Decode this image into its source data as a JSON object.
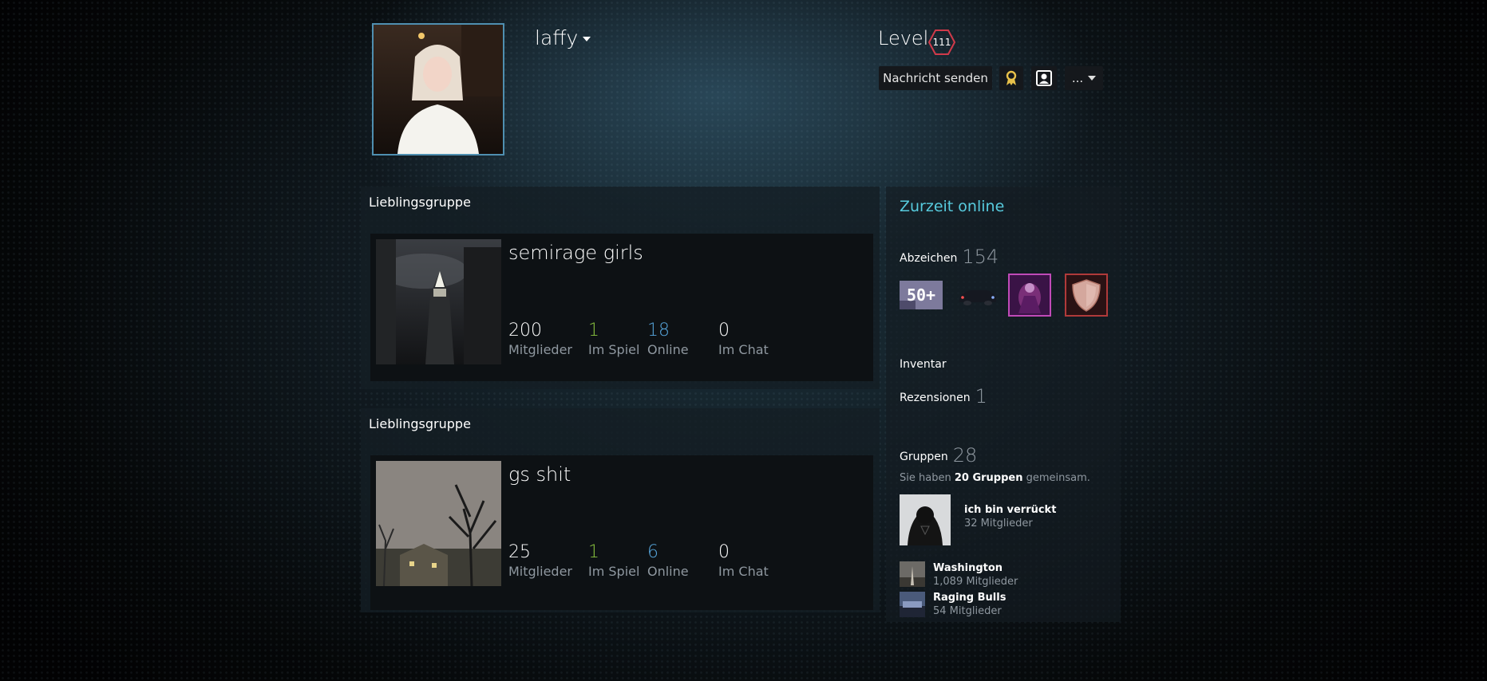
{
  "profile": {
    "username": "laffy",
    "level_label": "Level",
    "level": "111"
  },
  "actions": {
    "send_message": "Nachricht senden",
    "more": "..."
  },
  "favorite_groups": [
    {
      "title": "Lieblingsgruppe",
      "name": "semirage girls",
      "stats": [
        {
          "value": "200",
          "label": "Mitglieder"
        },
        {
          "value": "1",
          "label": "Im Spiel"
        },
        {
          "value": "18",
          "label": "Online"
        },
        {
          "value": "0",
          "label": "Im Chat"
        }
      ]
    },
    {
      "title": "Lieblingsgruppe",
      "name": "gs shit",
      "stats": [
        {
          "value": "25",
          "label": "Mitglieder"
        },
        {
          "value": "1",
          "label": "Im Spiel"
        },
        {
          "value": "6",
          "label": "Online"
        },
        {
          "value": "0",
          "label": "Im Chat"
        }
      ]
    }
  ],
  "sidebar": {
    "online_status": "Zurzeit online",
    "badges": {
      "label": "Abzeichen",
      "count": "154",
      "first_badge_text": "50+"
    },
    "inventory": {
      "label": "Inventar"
    },
    "reviews": {
      "label": "Rezensionen",
      "count": "1"
    },
    "groups": {
      "label": "Gruppen",
      "count": "28",
      "common_prefix": "Sie haben",
      "common_bold": "20 Gruppen",
      "common_suffix": "gemeinsam.",
      "items": [
        {
          "name": "ich bin verrückt",
          "members": "32 Mitglieder"
        },
        {
          "name": "Washington",
          "members": "1,089 Mitglieder"
        },
        {
          "name": "Raging Bulls",
          "members": "54 Mitglieder"
        }
      ]
    }
  },
  "colors": {
    "online": "#57cbde",
    "in_game": "#8bc53f",
    "group_online": "#57a7de",
    "level_badge": "#d03a4a"
  }
}
